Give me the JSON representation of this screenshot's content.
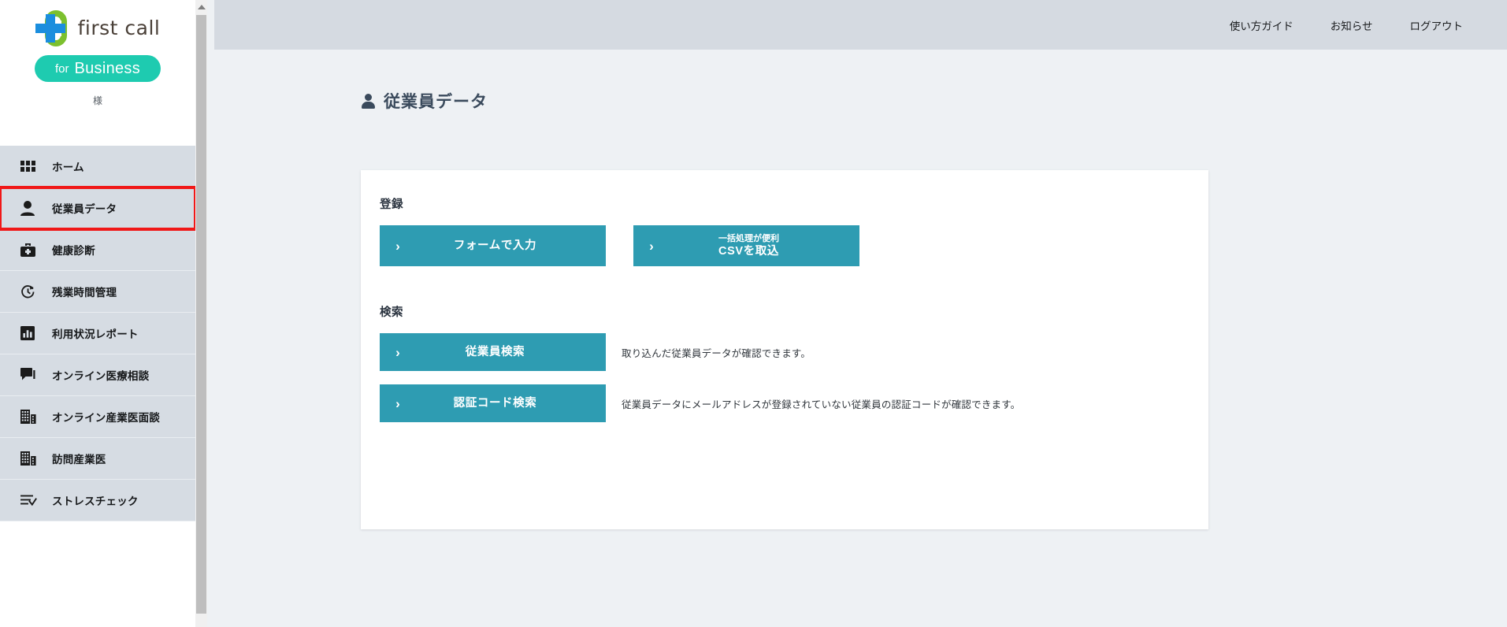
{
  "brand": {
    "logo_text": "first call",
    "badge_for": "for",
    "badge_name": "Business",
    "account_suffix": "様",
    "logo_icon": "firstcall-cross-logo",
    "colors": {
      "logo_green": "#7cc02e",
      "logo_blue": "#1b8ede",
      "badge_teal": "#1ecbb0"
    }
  },
  "sidebar": {
    "items": [
      {
        "label": "ホーム",
        "icon": "grid-icon",
        "highlighted": false
      },
      {
        "label": "従業員データ",
        "icon": "person-icon",
        "highlighted": true
      },
      {
        "label": "健康診断",
        "icon": "medical-bag-icon",
        "highlighted": false
      },
      {
        "label": "残業時間管理",
        "icon": "clock-refresh-icon",
        "highlighted": false
      },
      {
        "label": "利用状況レポート",
        "icon": "bar-chart-icon",
        "highlighted": false
      },
      {
        "label": "オンライン医療相談",
        "icon": "chat-bubble-icon",
        "highlighted": false
      },
      {
        "label": "オンライン産業医面談",
        "icon": "building-icon",
        "highlighted": false
      },
      {
        "label": "訪問産業医",
        "icon": "building-icon",
        "highlighted": false
      },
      {
        "label": "ストレスチェック",
        "icon": "checklist-icon",
        "highlighted": false
      }
    ],
    "highlight_color": "#f01818"
  },
  "scrollbar": {
    "up_arrow_icon": "triangle-up-icon",
    "thumb_icon": "scroll-thumb"
  },
  "topbar": {
    "links": [
      {
        "label": "使い方ガイド"
      },
      {
        "label": "お知らせ"
      },
      {
        "label": "ログアウト"
      }
    ]
  },
  "page": {
    "title": "従業員データ",
    "title_icon": "person-icon"
  },
  "card": {
    "register": {
      "heading": "登録",
      "buttons": [
        {
          "chevron": "›",
          "sub": "",
          "main": "フォームで入力",
          "name": "form-input-button"
        },
        {
          "chevron": "›",
          "sub": "一括処理が便利",
          "main": "CSVを取込",
          "name": "csv-import-button"
        }
      ]
    },
    "search": {
      "heading": "検索",
      "rows": [
        {
          "chevron": "›",
          "label": "従業員検索",
          "description": "取り込んだ従業員データが確認できます。",
          "name": "employee-search-button"
        },
        {
          "chevron": "›",
          "label": "認証コード検索",
          "description": "従業員データにメールアドレスが登録されていない従業員の認証コードが確認できます。",
          "name": "auth-code-search-button"
        }
      ]
    },
    "accent_color": "#2e9cb2"
  }
}
